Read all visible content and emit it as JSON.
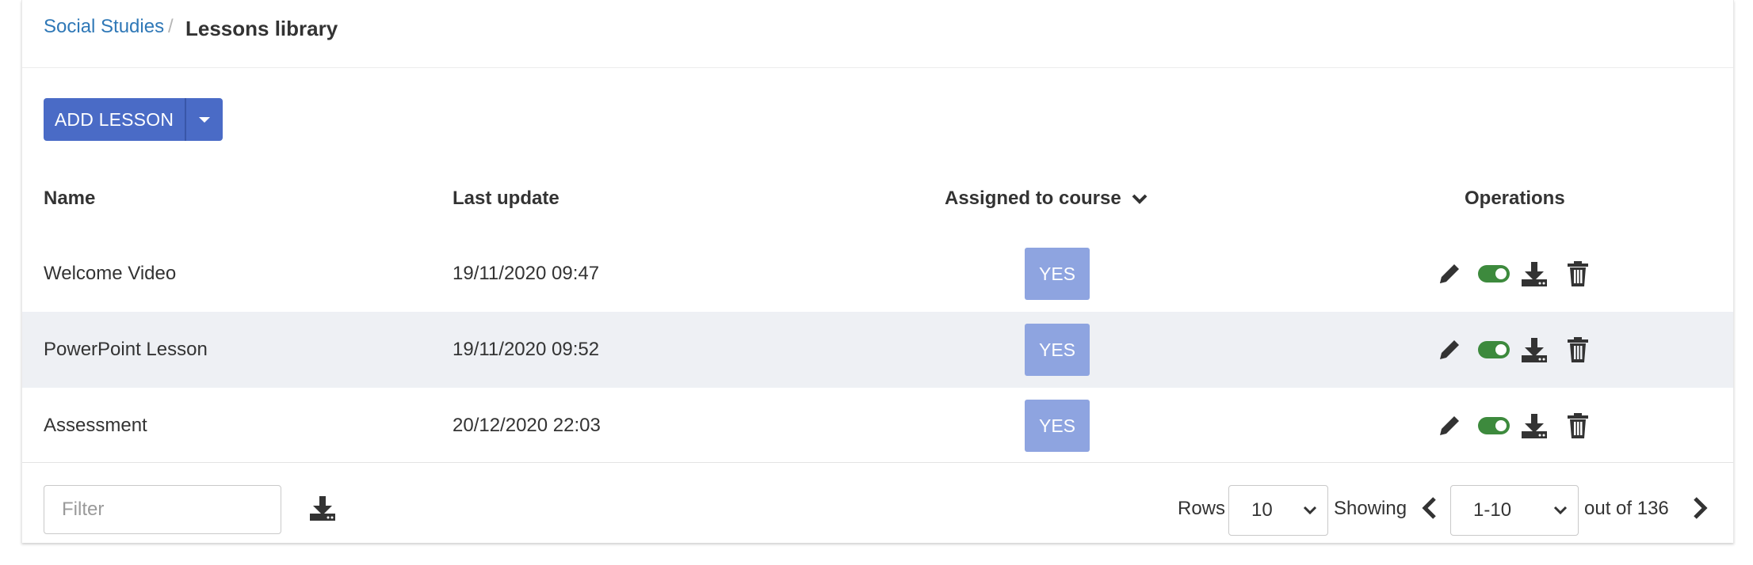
{
  "breadcrumb": {
    "parent": "Social Studies",
    "separator": "/",
    "current": "Lessons library"
  },
  "toolbar": {
    "add_label": "ADD LESSON"
  },
  "table": {
    "columns": {
      "name": "Name",
      "last_update": "Last update",
      "assigned": "Assigned to course",
      "operations": "Operations"
    },
    "rows": [
      {
        "name": "Welcome Video",
        "date": "19/11/2020 09:47",
        "assigned": "YES"
      },
      {
        "name": "PowerPoint Lesson",
        "date": "19/11/2020 09:52",
        "assigned": "YES"
      },
      {
        "name": "Assessment",
        "date": "20/12/2020 22:03",
        "assigned": "YES"
      }
    ]
  },
  "footer": {
    "filter_placeholder": "Filter",
    "rows_label": "Rows",
    "rows_value": "10",
    "showing_label": "Showing",
    "range_value": "1-10",
    "out_of": "out of 136"
  },
  "colors": {
    "primary": "#4a6bc6",
    "badge": "#8ea4e0",
    "toggle_on": "#3d8a3d",
    "link": "#2f78b7",
    "alt_row": "#eef0f4"
  },
  "icons": [
    "caret-down-icon",
    "chevron-down-icon",
    "pencil-icon",
    "toggle-on-icon",
    "download-icon",
    "trash-icon",
    "chevron-left-icon",
    "chevron-right-icon"
  ]
}
